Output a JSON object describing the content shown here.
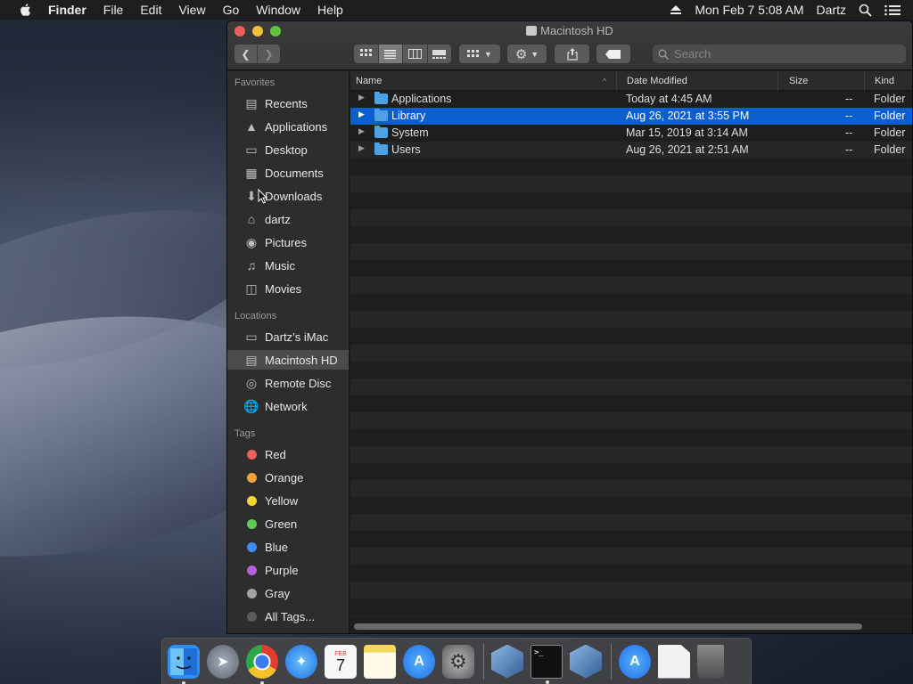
{
  "menubar": {
    "app_name": "Finder",
    "items": [
      "File",
      "Edit",
      "View",
      "Go",
      "Window",
      "Help"
    ],
    "clock": "Mon Feb 7  5:08 AM",
    "user": "Dartz"
  },
  "window": {
    "title": "Macintosh HD",
    "search_placeholder": "Search"
  },
  "sidebar": {
    "favorites_header": "Favorites",
    "favorites": [
      {
        "label": "Recents",
        "icon": "recents-icon"
      },
      {
        "label": "Applications",
        "icon": "applications-icon"
      },
      {
        "label": "Desktop",
        "icon": "desktop-icon"
      },
      {
        "label": "Documents",
        "icon": "documents-icon"
      },
      {
        "label": "Downloads",
        "icon": "downloads-icon"
      },
      {
        "label": "dartz",
        "icon": "home-icon"
      },
      {
        "label": "Pictures",
        "icon": "camera-icon"
      },
      {
        "label": "Music",
        "icon": "music-note-icon"
      },
      {
        "label": "Movies",
        "icon": "film-icon"
      }
    ],
    "locations_header": "Locations",
    "locations": [
      {
        "label": "Dartz’s iMac",
        "icon": "computer-icon"
      },
      {
        "label": "Macintosh HD",
        "icon": "hard-drive-icon",
        "selected": true
      },
      {
        "label": "Remote Disc",
        "icon": "disc-icon"
      },
      {
        "label": "Network",
        "icon": "network-icon"
      }
    ],
    "tags_header": "Tags",
    "tags": [
      {
        "label": "Red",
        "color": "#ec5f5a"
      },
      {
        "label": "Orange",
        "color": "#f2a33a"
      },
      {
        "label": "Yellow",
        "color": "#f5d630"
      },
      {
        "label": "Green",
        "color": "#5fcc55"
      },
      {
        "label": "Blue",
        "color": "#3d8ef0"
      },
      {
        "label": "Purple",
        "color": "#b65fdd"
      },
      {
        "label": "Gray",
        "color": "#a4a4a4"
      },
      {
        "label": "All Tags...",
        "color": "#5a5a5a"
      }
    ]
  },
  "list": {
    "columns": {
      "name": "Name",
      "date": "Date Modified",
      "size": "Size",
      "kind": "Kind"
    },
    "rows": [
      {
        "name": "Applications",
        "date": "Today at 4:45 AM",
        "size": "--",
        "kind": "Folder",
        "selected": false
      },
      {
        "name": "Library",
        "date": "Aug 26, 2021 at 3:55 PM",
        "size": "--",
        "kind": "Folder",
        "selected": true
      },
      {
        "name": "System",
        "date": "Mar 15, 2019 at 3:14 AM",
        "size": "--",
        "kind": "Folder",
        "selected": false
      },
      {
        "name": "Users",
        "date": "Aug 26, 2021 at 2:51 AM",
        "size": "--",
        "kind": "Folder",
        "selected": false
      }
    ]
  },
  "dock": {
    "apps": [
      {
        "name": "finder-icon",
        "running": true,
        "bg": "#2f8ef0"
      },
      {
        "name": "launchpad-icon",
        "running": false,
        "bg": "#7f8894"
      },
      {
        "name": "chrome-icon",
        "running": true,
        "bg": "#e8e8e8"
      },
      {
        "name": "safari-icon",
        "running": false,
        "bg": "#1f7ee8"
      },
      {
        "name": "calendar-icon",
        "running": false,
        "bg": "#f7f7f7"
      },
      {
        "name": "notes-icon",
        "running": false,
        "bg": "#f5d85a"
      },
      {
        "name": "app-store-icon",
        "running": false,
        "bg": "#2a8ff0"
      },
      {
        "name": "system-preferences-icon",
        "running": false,
        "bg": "#8b8b8b"
      },
      {
        "name": "virtualbox-icon",
        "running": false,
        "bg": "#3d6fa8"
      },
      {
        "name": "terminal-icon",
        "running": true,
        "bg": "#111111"
      },
      {
        "name": "virtualbox-icon-2",
        "running": false,
        "bg": "#3d6fa8"
      },
      {
        "name": "app-store-download-icon",
        "running": false,
        "bg": "#2a8ff0"
      },
      {
        "name": "document-icon",
        "running": false,
        "bg": "#f2f2f2"
      },
      {
        "name": "trash-icon",
        "running": false,
        "bg": "#6b6b6b"
      }
    ],
    "calendar_month": "FEB",
    "calendar_day": "7"
  }
}
